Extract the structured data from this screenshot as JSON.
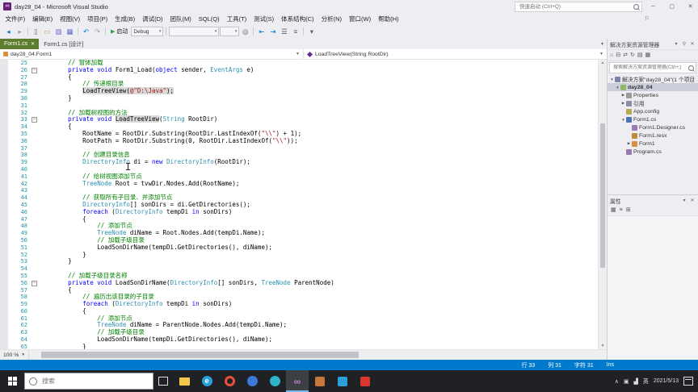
{
  "colors": {
    "accent": "#007acc",
    "tab_active": "#5e7d2e",
    "comment_green": "#008000",
    "keyword_blue": "#0000ff",
    "type_teal": "#2b91af",
    "string_red": "#a31515",
    "reference_highlight": "#d9d9d9",
    "taskbar_bg": "#202124",
    "line_number": "#2b91af"
  },
  "titlebar": {
    "title": "day28_04 - Microsoft Visual Studio",
    "quick_launch": "快速启动 (Ctrl+Q)"
  },
  "menubar": {
    "items": [
      "文件(F)",
      "编辑(E)",
      "视图(V)",
      "项目(P)",
      "生成(B)",
      "调试(D)",
      "团队(M)",
      "SQL(Q)",
      "工具(T)",
      "测试(S)",
      "体系结构(C)",
      "分析(N)",
      "窗口(W)",
      "帮助(H)"
    ]
  },
  "toolbar": {
    "items": [
      {
        "t": "i",
        "n": "nav-backward-icon",
        "g": "◂",
        "c": "#007acc"
      },
      {
        "t": "i",
        "n": "nav-forward-icon",
        "g": "▸",
        "c": "#999da6"
      },
      {
        "t": "s"
      },
      {
        "t": "i",
        "n": "new-file-icon",
        "g": "▯",
        "c": "#5b6069"
      },
      {
        "t": "i",
        "n": "open-file-icon",
        "g": "▭",
        "c": "#c9a24a"
      },
      {
        "t": "i",
        "n": "save-icon",
        "g": "▥",
        "c": "#5f64c8"
      },
      {
        "t": "i",
        "n": "save-all-icon",
        "g": "▦",
        "c": "#5f64c8"
      },
      {
        "t": "s"
      },
      {
        "t": "i",
        "n": "undo-icon",
        "g": "↶",
        "c": "#007acc"
      },
      {
        "t": "i",
        "n": "redo-icon",
        "g": "↷",
        "c": "#999da6"
      },
      {
        "t": "s"
      },
      {
        "t": "start",
        "n": "start-debug-button",
        "g": "▶",
        "label": "启动",
        "c": "#3a9e3a"
      },
      {
        "t": "dd",
        "n": "debug-config-dropdown",
        "label": "Debug",
        "w": 40
      },
      {
        "t": "s"
      },
      {
        "t": "dd",
        "n": "platform-dropdown",
        "label": "",
        "w": 62
      },
      {
        "t": "dd",
        "n": "run-target-dropdown",
        "label": "",
        "w": 24
      },
      {
        "t": "i",
        "n": "find-icon",
        "g": "◎",
        "c": "#5b6069"
      },
      {
        "t": "s"
      },
      {
        "t": "i",
        "n": "decrease-indent-icon",
        "g": "⇤",
        "c": "#007acc"
      },
      {
        "t": "i",
        "n": "increase-indent-icon",
        "g": "⇥",
        "c": "#007acc"
      },
      {
        "t": "i",
        "n": "comment-icon",
        "g": "☰",
        "c": "#5b6069"
      },
      {
        "t": "i",
        "n": "uncomment-icon",
        "g": "≡",
        "c": "#5b6069"
      },
      {
        "t": "s"
      },
      {
        "t": "i",
        "n": "toolbar-overflow-icon",
        "g": "▾",
        "c": "#5b6069"
      }
    ]
  },
  "tabs": {
    "active": "Form1.cs",
    "inactive": "Form1.cs [设计]"
  },
  "breadcrumb": {
    "left": "day28_04.Form1",
    "right": "LoadTreeView(String RootDir)"
  },
  "editor": {
    "lines": [
      {
        "n": 25,
        "f": "",
        "segs": [
          [
            "c",
            "        // 窗体加载"
          ]
        ]
      },
      {
        "n": 26,
        "f": "-",
        "segs": [
          [
            "k",
            "        private"
          ],
          [
            "p",
            " "
          ],
          [
            "k",
            "void"
          ],
          [
            "p",
            " Form1_Load("
          ],
          [
            "k",
            "object"
          ],
          [
            "p",
            " sender, "
          ],
          [
            "t",
            "EventArgs"
          ],
          [
            "p",
            " e)"
          ]
        ]
      },
      {
        "n": 27,
        "f": "",
        "segs": [
          [
            "p",
            "        {"
          ]
        ]
      },
      {
        "n": 28,
        "f": "",
        "segs": [
          [
            "c",
            "            // 传递根目录"
          ]
        ]
      },
      {
        "n": 29,
        "f": "",
        "segs": [
          [
            "p",
            "            "
          ],
          [
            "h",
            "LoadTreeView("
          ],
          [
            "hs",
            "@\"D:\\Java\""
          ],
          [
            "h",
            ");"
          ]
        ]
      },
      {
        "n": 30,
        "f": "",
        "segs": [
          [
            "p",
            "        }"
          ]
        ]
      },
      {
        "n": 31,
        "f": "",
        "segs": []
      },
      {
        "n": 32,
        "f": "",
        "segs": [
          [
            "c",
            "        // 加载树视图的方法"
          ]
        ]
      },
      {
        "n": 33,
        "f": "-",
        "segs": [
          [
            "k",
            "        private"
          ],
          [
            "p",
            " "
          ],
          [
            "k",
            "void"
          ],
          [
            "p",
            " "
          ],
          [
            "h",
            "LoadTreeView"
          ],
          [
            "p",
            "("
          ],
          [
            "t",
            "String"
          ],
          [
            "p",
            " RootDir)"
          ]
        ]
      },
      {
        "n": 34,
        "f": "",
        "segs": [
          [
            "p",
            "        {"
          ]
        ]
      },
      {
        "n": 35,
        "f": "",
        "segs": [
          [
            "p",
            "            RootName = RootDir.Substring(RootDir.LastIndexOf("
          ],
          [
            "s",
            "\"\\\\\""
          ],
          [
            "p",
            ") + 1);"
          ]
        ]
      },
      {
        "n": 36,
        "f": "",
        "segs": [
          [
            "p",
            "            RootPath = RootDir.Substring(0, RootDir.LastIndexOf("
          ],
          [
            "s",
            "\"\\\\\""
          ],
          [
            "p",
            "));"
          ]
        ]
      },
      {
        "n": 37,
        "f": "",
        "segs": []
      },
      {
        "n": 38,
        "f": "",
        "segs": [
          [
            "c",
            "            // 创建目录信息"
          ]
        ]
      },
      {
        "n": 39,
        "f": "",
        "segs": [
          [
            "t",
            "            DirectoryInfo"
          ],
          [
            "p",
            " di = "
          ],
          [
            "k",
            "new"
          ],
          [
            "p",
            " "
          ],
          [
            "t",
            "DirectoryInfo"
          ],
          [
            "p",
            "(RootDir);"
          ]
        ]
      },
      {
        "n": 40,
        "f": "",
        "segs": []
      },
      {
        "n": 41,
        "f": "",
        "segs": [
          [
            "c",
            "            // 给树视图添加节点"
          ]
        ]
      },
      {
        "n": 42,
        "f": "",
        "segs": [
          [
            "t",
            "            TreeNode"
          ],
          [
            "p",
            " Root = tvwDir.Nodes.Add(RootName);"
          ]
        ]
      },
      {
        "n": 43,
        "f": "",
        "segs": []
      },
      {
        "n": 44,
        "f": "",
        "segs": [
          [
            "c",
            "            // 获取所有子目录、并添加节点"
          ]
        ]
      },
      {
        "n": 45,
        "f": "",
        "segs": [
          [
            "t",
            "            DirectoryInfo"
          ],
          [
            "p",
            "[] sonDirs = di.GetDirectories();"
          ]
        ]
      },
      {
        "n": 46,
        "f": "",
        "segs": [
          [
            "p",
            "            "
          ],
          [
            "k",
            "foreach"
          ],
          [
            "p",
            " ("
          ],
          [
            "t",
            "DirectoryInfo"
          ],
          [
            "p",
            " tempDi "
          ],
          [
            "k",
            "in"
          ],
          [
            "p",
            " sonDirs)"
          ]
        ]
      },
      {
        "n": 47,
        "f": "",
        "segs": [
          [
            "p",
            "            {"
          ]
        ]
      },
      {
        "n": 48,
        "f": "",
        "segs": [
          [
            "c",
            "                // 添加节点"
          ]
        ]
      },
      {
        "n": 49,
        "f": "",
        "segs": [
          [
            "t",
            "                TreeNode"
          ],
          [
            "p",
            " diName = Root.Nodes.Add(tempDi.Name);"
          ]
        ]
      },
      {
        "n": 50,
        "f": "",
        "segs": [
          [
            "c",
            "                // 加载子级目录"
          ]
        ]
      },
      {
        "n": 51,
        "f": "",
        "segs": [
          [
            "p",
            "                LoadSonDirName(tempDi.GetDirectories(), diName);"
          ]
        ]
      },
      {
        "n": 52,
        "f": "",
        "segs": [
          [
            "p",
            "            }"
          ]
        ]
      },
      {
        "n": 53,
        "f": "",
        "segs": [
          [
            "p",
            "        }"
          ]
        ]
      },
      {
        "n": 54,
        "f": "",
        "segs": []
      },
      {
        "n": 55,
        "f": "",
        "segs": [
          [
            "c",
            "        // 加载子级目录名称"
          ]
        ]
      },
      {
        "n": 56,
        "f": "-",
        "segs": [
          [
            "k",
            "        private"
          ],
          [
            "p",
            " "
          ],
          [
            "k",
            "void"
          ],
          [
            "p",
            " LoadSonDirName("
          ],
          [
            "t",
            "DirectoryInfo"
          ],
          [
            "p",
            "[] sonDirs, "
          ],
          [
            "t",
            "TreeNode"
          ],
          [
            "p",
            " ParentNode)"
          ]
        ]
      },
      {
        "n": 57,
        "f": "",
        "segs": [
          [
            "p",
            "        {"
          ]
        ]
      },
      {
        "n": 58,
        "f": "",
        "segs": [
          [
            "c",
            "            // 遍历出该目录的子目录"
          ]
        ]
      },
      {
        "n": 59,
        "f": "",
        "segs": [
          [
            "p",
            "            "
          ],
          [
            "k",
            "foreach"
          ],
          [
            "p",
            " ("
          ],
          [
            "t",
            "DirectoryInfo"
          ],
          [
            "p",
            " tempDi "
          ],
          [
            "k",
            "in"
          ],
          [
            "p",
            " sonDirs)"
          ]
        ]
      },
      {
        "n": 60,
        "f": "",
        "segs": [
          [
            "p",
            "            {"
          ]
        ]
      },
      {
        "n": 61,
        "f": "",
        "segs": [
          [
            "c",
            "                // 添加节点"
          ]
        ]
      },
      {
        "n": 62,
        "f": "",
        "segs": [
          [
            "t",
            "                TreeNode"
          ],
          [
            "p",
            " diName = ParentNode.Nodes.Add(tempDi.Name);"
          ]
        ]
      },
      {
        "n": 63,
        "f": "",
        "segs": [
          [
            "c",
            "                // 加载子级目录"
          ]
        ]
      },
      {
        "n": 64,
        "f": "",
        "segs": [
          [
            "p",
            "                LoadSonDirName(tempDi.GetDirectories(), diName);"
          ]
        ]
      },
      {
        "n": 65,
        "f": "",
        "segs": [
          [
            "p",
            "            }"
          ]
        ]
      }
    ]
  },
  "editor_bottom": {
    "zoom": "100 %"
  },
  "statusbar": {
    "line": "行 33",
    "col": "列 31",
    "char": "字符 31",
    "mode": "Ins"
  },
  "solution_explorer": {
    "title": "解决方案资源管理器",
    "search_placeholder": "搜索解决方案资源管理器(Ctrl+;)",
    "toolbar": [
      {
        "n": "home-icon",
        "g": "⌂"
      },
      {
        "n": "collapse-all-icon",
        "g": "⊟"
      },
      {
        "n": "sync-with-active-document-icon",
        "g": "⇄"
      },
      {
        "n": "refresh-icon",
        "g": "↻"
      },
      {
        "n": "show-all-files-icon",
        "g": "▤"
      },
      {
        "n": "properties-icon",
        "g": "▦"
      }
    ],
    "items": [
      {
        "label": "解决方案\"day28_04\"(1 个项目",
        "indent": 0,
        "exp": "▼",
        "icon": "solution-icon",
        "color": "#7a86a8",
        "bold": false,
        "selected": false
      },
      {
        "label": "day28_04",
        "indent": 1,
        "exp": "▼",
        "icon": "csharp-project-icon",
        "color": "#8fb868",
        "bold": true,
        "selected": true
      },
      {
        "label": "Properties",
        "indent": 2,
        "exp": "▶",
        "icon": "properties-folder-icon",
        "color": "#9a9a9a",
        "bold": false,
        "selected": false
      },
      {
        "label": "引用",
        "indent": 2,
        "exp": "▶",
        "icon": "references-icon",
        "color": "#8a8fa8",
        "bold": false,
        "selected": false
      },
      {
        "label": "App.config",
        "indent": 2,
        "exp": "",
        "icon": "config-file-icon",
        "color": "#b8a84e",
        "bold": false,
        "selected": false
      },
      {
        "label": "Form1.cs",
        "indent": 2,
        "exp": "▼",
        "icon": "form-icon",
        "color": "#4a76b8",
        "bold": false,
        "selected": false
      },
      {
        "label": "Form1.Designer.cs",
        "indent": 3,
        "exp": "",
        "icon": "cs-file-icon",
        "color": "#9a7ab0",
        "bold": false,
        "selected": false
      },
      {
        "label": "Form1.resx",
        "indent": 3,
        "exp": "",
        "icon": "resx-file-icon",
        "color": "#c08a3e",
        "bold": false,
        "selected": false
      },
      {
        "label": "Form1",
        "indent": 3,
        "exp": "▶",
        "icon": "class-icon",
        "color": "#d8903f",
        "bold": false,
        "selected": false
      },
      {
        "label": "Program.cs",
        "indent": 2,
        "exp": "",
        "icon": "cs-file-icon",
        "color": "#9a7ab0",
        "bold": false,
        "selected": false
      }
    ]
  },
  "properties_panel": {
    "title": "属性",
    "toolbar": [
      {
        "n": "categorized-icon",
        "g": "▦"
      },
      {
        "n": "alphabetical-icon",
        "g": "≡"
      },
      {
        "n": "property-pages-icon",
        "g": "⊞"
      }
    ]
  },
  "taskbar": {
    "search_placeholder": "搜索",
    "lang": "英",
    "date": "2021/5/13",
    "apps": [
      {
        "name": "file-explorer-icon",
        "shape": "folder",
        "color": "#f5c84c",
        "active": false
      },
      {
        "name": "edge-icon",
        "shape": "circle",
        "color": "#2a9fd8",
        "letter": "e",
        "active": false
      },
      {
        "name": "browser-icon",
        "shape": "ring",
        "color": "#e8513c",
        "active": false
      },
      {
        "name": "app-icon-blue",
        "shape": "circle",
        "color": "#3b78d8",
        "active": false
      },
      {
        "name": "app-icon-teal",
        "shape": "circle",
        "color": "#2fb3c7",
        "active": false
      },
      {
        "name": "visual-studio-icon",
        "shape": "vs",
        "color": "#b885c8",
        "active": true
      },
      {
        "name": "app-icon-orange",
        "shape": "square",
        "color": "#c7763c",
        "active": false
      },
      {
        "name": "vscode-icon",
        "shape": "square",
        "color": "#2b9fd8",
        "active": false
      },
      {
        "name": "app-icon-red",
        "shape": "square",
        "color": "#d8372e",
        "active": false
      }
    ],
    "tray": [
      {
        "n": "hidden-icons-chevron",
        "g": "∧"
      },
      {
        "n": "tray-icon-1",
        "g": "▣"
      },
      {
        "n": "network-icon",
        "g": "▟"
      }
    ]
  }
}
